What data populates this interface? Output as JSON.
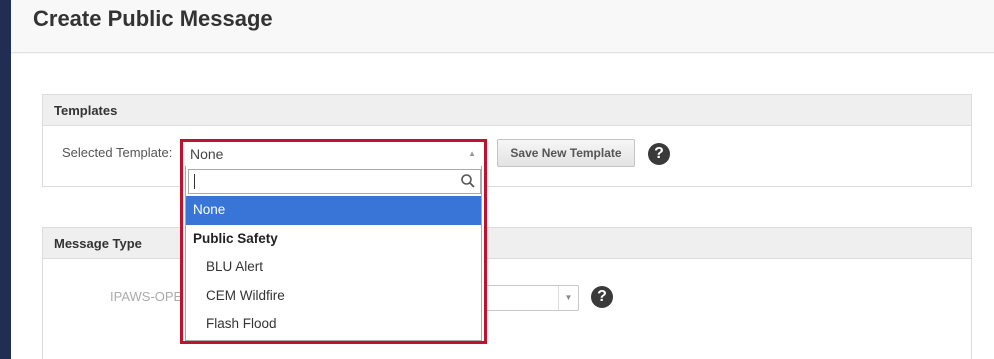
{
  "header": {
    "title": "Create Public Message"
  },
  "templates": {
    "heading": "Templates",
    "selected_label": "Selected Template:",
    "selected_value": "None",
    "save_button": "Save New Template",
    "help": "?"
  },
  "dropdown": {
    "search_value": "",
    "options": [
      {
        "label": "None",
        "type": "option",
        "selected": true
      },
      {
        "label": "Public Safety",
        "type": "group"
      },
      {
        "label": "BLU Alert",
        "type": "child"
      },
      {
        "label": "CEM Wildfire",
        "type": "child"
      },
      {
        "label": "Flash Flood",
        "type": "child"
      }
    ]
  },
  "message_type": {
    "heading": "Message Type",
    "label": "IPAWS-OPEN",
    "help": "?"
  },
  "colors": {
    "highlight_border": "#c0122c",
    "selected_option": "#3875d7",
    "sidebar": "#1f2e52"
  }
}
